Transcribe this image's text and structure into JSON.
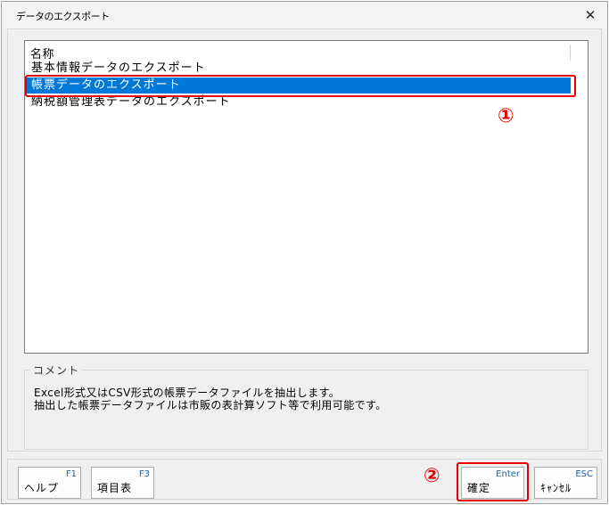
{
  "window": {
    "title": "データのエクスポート",
    "close_glyph": "✕"
  },
  "list": {
    "header": "名称",
    "items": [
      "基本情報データのエクスポート",
      "帳票データのエクスポート",
      "納税額管理表データのエクスポート"
    ],
    "selected_index": 1
  },
  "annotations": {
    "marker_1": "①",
    "marker_2": "②",
    "highlight_color": "#e60000"
  },
  "comment": {
    "label": "コメント",
    "lines": [
      "Excel形式又はCSV形式の帳票データファイルを抽出します。",
      "抽出した帳票データファイルは市販の表計算ソフト等で利用可能です。"
    ]
  },
  "footer": {
    "buttons": [
      {
        "key": "F1",
        "label": "ヘルプ"
      },
      {
        "key": "F3",
        "label": "項目表"
      },
      {
        "key": "Enter",
        "label": "確定"
      },
      {
        "key": "ESC",
        "label": "ｷｬﾝｾﾙ"
      }
    ]
  },
  "colors": {
    "selection": "#0078d7",
    "function_key_text": "#1f5f9f"
  }
}
